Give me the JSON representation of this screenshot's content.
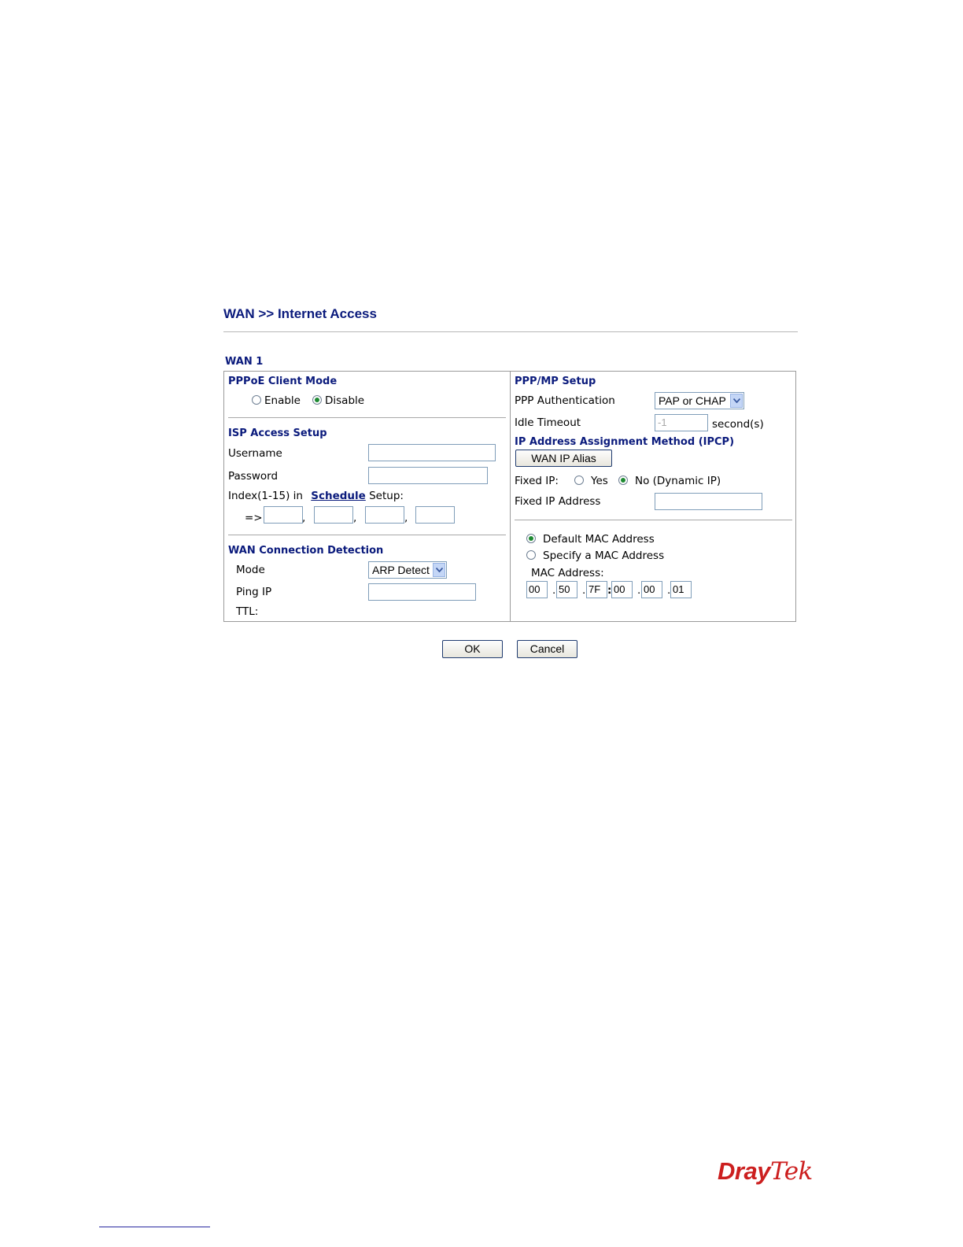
{
  "page": {
    "title": "WAN >> Internet Access"
  },
  "wan": {
    "label": "WAN 1"
  },
  "pppoe": {
    "section_title": "PPPoE Client Mode",
    "enable_label": "Enable",
    "disable_label": "Disable",
    "selected": "Disable"
  },
  "isp": {
    "section_title": "ISP Access Setup",
    "username_label": "Username",
    "password_label": "Password",
    "index_prefix": "Index(1-15) in",
    "schedule_link": "Schedule",
    "index_suffix": "Setup:",
    "arrow": "=>",
    "comma": ","
  },
  "detection": {
    "section_title": "WAN Connection Detection",
    "mode_label": "Mode",
    "mode_value": "ARP Detect",
    "ping_label": "Ping IP",
    "ttl_label": "TTL:"
  },
  "ppp": {
    "section_title": "PPP/MP Setup",
    "auth_label": "PPP Authentication",
    "auth_value": "PAP or CHAP",
    "idle_label": "Idle Timeout",
    "idle_value": "-1",
    "idle_unit": "second(s)"
  },
  "ipcp": {
    "section_title": "IP Address Assignment Method (IPCP)",
    "alias_button": "WAN IP Alias",
    "fixed_ip_label": "Fixed IP:",
    "yes_label": "Yes",
    "no_label": "No (Dynamic IP)",
    "fixed_addr_label": "Fixed IP Address"
  },
  "mac": {
    "default_label": "Default MAC Address",
    "specify_label": "Specify a MAC Address",
    "address_label": "MAC Address:",
    "octets": [
      "00",
      "50",
      "7F",
      "00",
      "00",
      "01"
    ],
    "sep_dot": ".",
    "sep_colon": ":"
  },
  "actions": {
    "ok": "OK",
    "cancel": "Cancel"
  },
  "brand": {
    "part1": "Dray",
    "part2": "Tek",
    "color": "#cc1f1f"
  },
  "colors": {
    "section_title": "#0a1a7c",
    "radio_selected": "#1e8a32"
  }
}
